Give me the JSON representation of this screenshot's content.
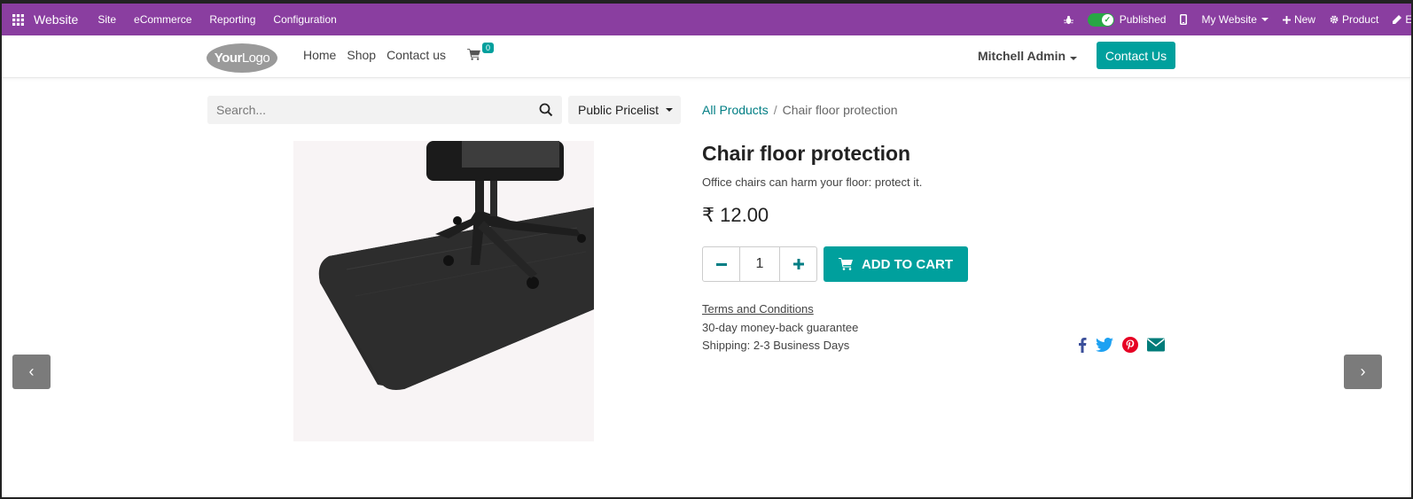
{
  "adminbar": {
    "brand": "Website",
    "menus": [
      "Site",
      "eCommerce",
      "Reporting",
      "Configuration"
    ],
    "published_label": "Published",
    "my_website_label": "My Website",
    "new_label": "New",
    "product_label": "Product",
    "edit_label": "Edit"
  },
  "header": {
    "logo_bold": "Your",
    "logo_rest": "Logo",
    "nav": [
      "Home",
      "Shop",
      "Contact us"
    ],
    "cart_count": "0",
    "user": "Mitchell Admin",
    "contact_button": "Contact Us"
  },
  "search": {
    "placeholder": "Search...",
    "value": ""
  },
  "pricelist": {
    "label": "Public Pricelist"
  },
  "breadcrumb": {
    "parent": "All Products",
    "separator": "/",
    "current": "Chair floor protection"
  },
  "product": {
    "title": "Chair floor protection",
    "description": "Office chairs can harm your floor: protect it.",
    "price": "₹ 12.00",
    "quantity": "1",
    "add_to_cart": "ADD TO CART",
    "terms": "Terms and Conditions",
    "guarantee": "30-day money-back guarantee",
    "shipping": "Shipping: 2-3 Business Days"
  },
  "carousel": {
    "prev": "‹",
    "next": "›"
  },
  "colors": {
    "admin_bar": "#8a3ea0",
    "primary": "#00a09d",
    "link": "#017e84"
  },
  "icons": [
    "apps-icon",
    "bug-icon",
    "mobile-icon",
    "plus-icon",
    "gear-icon",
    "pencil-icon",
    "cart-icon",
    "search-icon",
    "facebook-icon",
    "twitter-icon",
    "pinterest-icon",
    "email-icon"
  ]
}
